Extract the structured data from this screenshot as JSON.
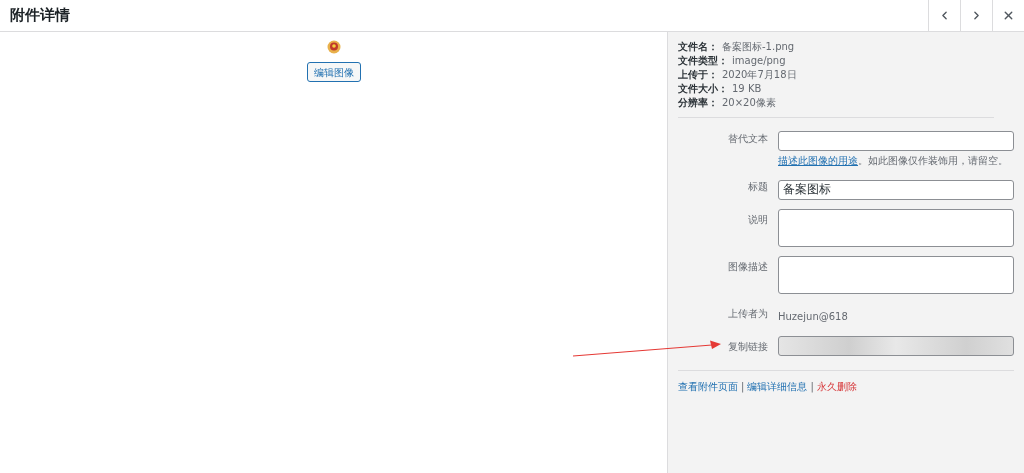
{
  "header": {
    "title": "附件详情",
    "buttons": [
      {
        "kind": "previous"
      },
      {
        "kind": "next"
      },
      {
        "kind": "close"
      }
    ]
  },
  "preview": {
    "edit_button": "编辑图像"
  },
  "file_info": [
    {
      "label": "文件名：",
      "value": "备案图标-1.png"
    },
    {
      "label": "文件类型：",
      "value": "image/png"
    },
    {
      "label": "上传于：",
      "value": "2020年7月18日"
    },
    {
      "label": "文件大小：",
      "value": "19 KB"
    },
    {
      "label": "分辨率：",
      "value": "20×20像素"
    }
  ],
  "fields": [
    {
      "kind": "input",
      "label": "替代文本",
      "help_link": "描述此图像的用途",
      "help_text": "。如此图像仅作装饰用，请留空。"
    },
    {
      "kind": "input",
      "label": "标题",
      "value": "备案图标"
    },
    {
      "kind": "textarea",
      "label": "说明"
    },
    {
      "kind": "textarea",
      "label": "图像描述"
    },
    {
      "kind": "static",
      "label": "上传者为",
      "value": "Huzejun@618"
    },
    {
      "kind": "blurred",
      "label": "复制链接"
    }
  ],
  "action_separator": "|",
  "actions": [
    {
      "label": "查看附件页面",
      "kind": "link"
    },
    {
      "label": "编辑详细信息",
      "kind": "link"
    },
    {
      "label": "永久删除",
      "kind": "delete"
    }
  ]
}
